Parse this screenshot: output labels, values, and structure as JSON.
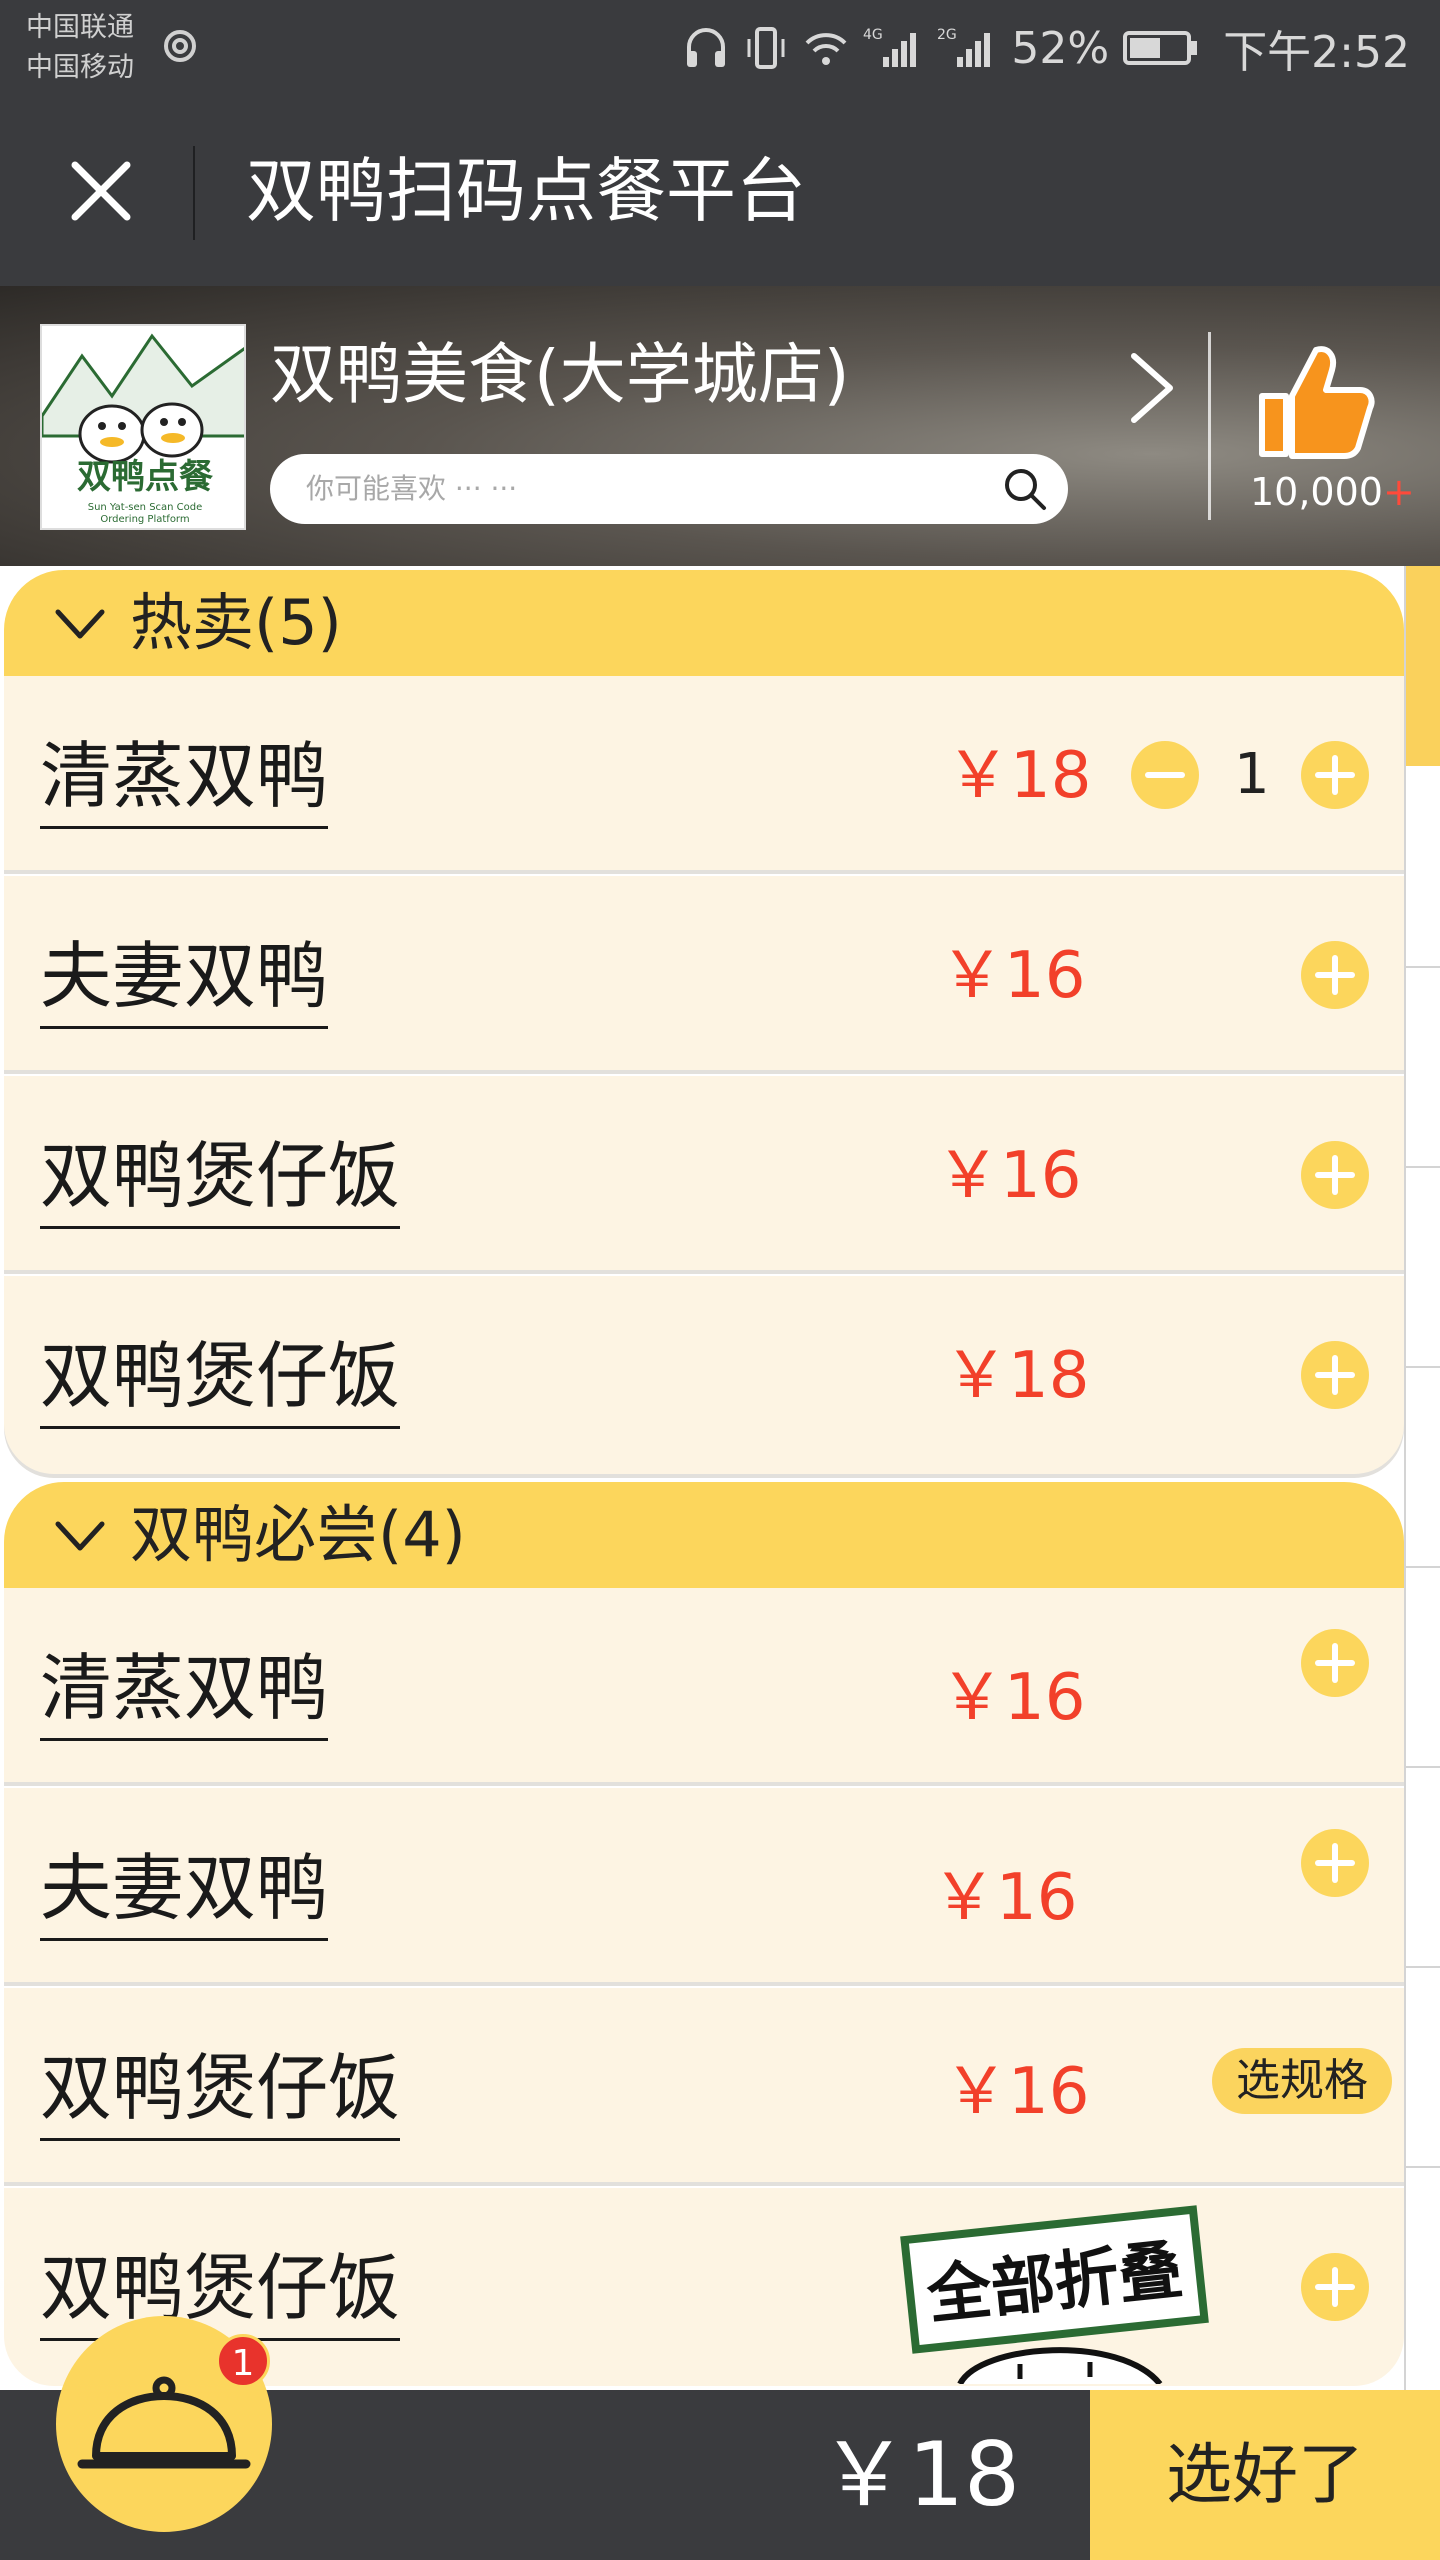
{
  "status_bar": {
    "carrier_1": "中国联通",
    "carrier_2": "中国移动",
    "network_1": "4G",
    "network_2": "2G",
    "battery": "52%",
    "time": "下午2:52"
  },
  "title_bar": {
    "title": "双鸭扫码点餐平台"
  },
  "store": {
    "name": "双鸭美食(大学城店)",
    "search_placeholder": "你可能喜欢 ··· ···",
    "likes": "10,000",
    "likes_suffix": "+",
    "logo_text": "双鸭点餐",
    "logo_subtext_1": "Sun Yat-sen Scan Code",
    "logo_subtext_2": "Ordering Platform"
  },
  "sections": [
    {
      "label": "热卖(5)",
      "items": [
        {
          "name": "清蒸双鸭",
          "price": "￥18",
          "quantity": "1"
        },
        {
          "name": "夫妻双鸭",
          "price": "￥16"
        },
        {
          "name": "双鸭煲仔饭",
          "price": "￥16"
        },
        {
          "name": "双鸭煲仔饭",
          "price": "￥18"
        }
      ]
    },
    {
      "label": "双鸭必尝(4)",
      "items": [
        {
          "name": "清蒸双鸭",
          "price": "￥16"
        },
        {
          "name": "夫妻双鸭",
          "price": "￥16"
        },
        {
          "name": "双鸭煲仔饭",
          "price": "￥16",
          "spec_label": "选规格"
        },
        {
          "name": "双鸭煲仔饭",
          "price": ""
        }
      ]
    }
  ],
  "collapse_all_label": "全部折叠",
  "bottom_bar": {
    "total": "￥18",
    "checkout_label": "选好了",
    "cart_badge": "1"
  },
  "colors": {
    "accent_yellow": "#fcd65c",
    "price_red": "#f2402a",
    "bar_dark": "#3a3b3e",
    "item_bg": "#fdf4e3"
  }
}
